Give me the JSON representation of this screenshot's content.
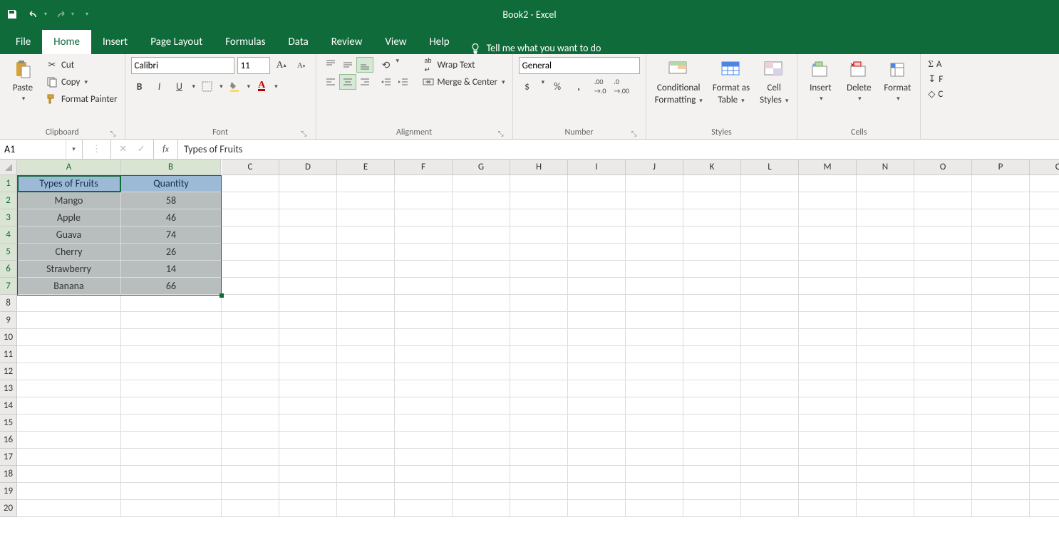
{
  "app": {
    "title": "Book2  -  Excel"
  },
  "tabs": {
    "file": "File",
    "home": "Home",
    "insert": "Insert",
    "pagelayout": "Page Layout",
    "formulas": "Formulas",
    "data": "Data",
    "review": "Review",
    "view": "View",
    "help": "Help",
    "tellme": "Tell me what you want to do"
  },
  "ribbon": {
    "clipboard": {
      "label": "Clipboard",
      "paste": "Paste",
      "cut": "Cut",
      "copy": "Copy",
      "fmtpainter": "Format Painter"
    },
    "font": {
      "label": "Font",
      "name": "Calibri",
      "size": "11"
    },
    "alignment": {
      "label": "Alignment",
      "wrap": "Wrap Text",
      "merge": "Merge & Center"
    },
    "number": {
      "label": "Number",
      "format": "General"
    },
    "styles": {
      "label": "Styles",
      "cond": "Conditional",
      "cond2": "Formatting",
      "ftable": "Format as",
      "ftable2": "Table",
      "cellstyles": "Cell",
      "cellstyles2": "Styles"
    },
    "cells": {
      "label": "Cells",
      "insert": "Insert",
      "delete": "Delete",
      "format": "Format"
    }
  },
  "namebox": "A1",
  "formula": "Types of Fruits",
  "columns": [
    "A",
    "B",
    "C",
    "D",
    "E",
    "F",
    "G",
    "H",
    "I",
    "J",
    "K",
    "L",
    "M",
    "N",
    "O",
    "P",
    "Q"
  ],
  "rows": [
    "1",
    "2",
    "3",
    "4",
    "5",
    "6",
    "7",
    "8",
    "9",
    "10",
    "11",
    "12",
    "13",
    "14",
    "15",
    "16",
    "17",
    "18",
    "19",
    "20"
  ],
  "data": {
    "headers": [
      "Types of Fruits",
      "Quantity"
    ],
    "rows": [
      {
        "a": "Mango",
        "b": "58"
      },
      {
        "a": "Apple",
        "b": "46"
      },
      {
        "a": "Guava",
        "b": "74"
      },
      {
        "a": "Cherry",
        "b": "26"
      },
      {
        "a": "Strawberry",
        "b": "14"
      },
      {
        "a": "Banana",
        "b": "66"
      }
    ]
  },
  "chart_data": {
    "type": "table",
    "title": "",
    "columns": [
      "Types of Fruits",
      "Quantity"
    ],
    "categories": [
      "Mango",
      "Apple",
      "Guava",
      "Cherry",
      "Strawberry",
      "Banana"
    ],
    "values": [
      58,
      46,
      74,
      26,
      14,
      66
    ]
  }
}
